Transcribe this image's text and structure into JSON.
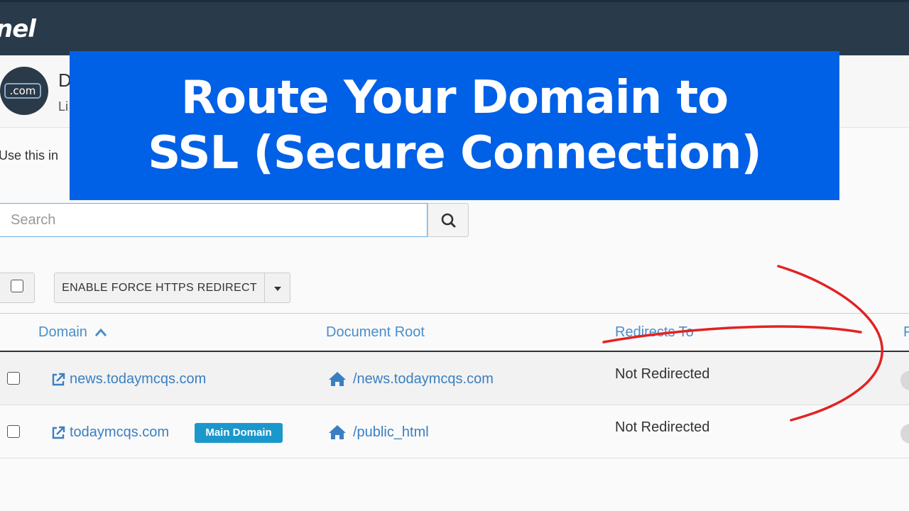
{
  "topbar": {
    "logo_fragment": "nel"
  },
  "header": {
    "icon_label": ".com",
    "title_fragment": "D",
    "subtitle_fragment": "Li",
    "intro_fragment": "Use this in"
  },
  "banner": {
    "line1": "Route Your Domain to",
    "line2": "SSL (Secure Connection)",
    "color": "#0060e6"
  },
  "search": {
    "placeholder": "Search",
    "value": ""
  },
  "toolbar": {
    "enable_label": "ENABLE FORCE HTTPS REDIRECT"
  },
  "table": {
    "headers": {
      "domain": "Domain",
      "doc_root": "Document Root",
      "redirects_to": "Redirects To",
      "force": "F"
    },
    "rows": [
      {
        "domain": "news.todaymcqs.com",
        "doc_root": "/news.todaymcqs.com",
        "redirect": "Not Redirected",
        "badge": ""
      },
      {
        "domain": "todaymcqs.com",
        "doc_root": "/public_html",
        "redirect": "Not Redirected",
        "badge": "Main Domain"
      }
    ]
  },
  "icons": [
    "external-link-icon",
    "home-icon",
    "search-icon",
    "sort-up-icon",
    "caret-down-icon"
  ],
  "colors": {
    "topbar": "#293a4a",
    "link": "#3a7fc1",
    "badge": "#1a98cc",
    "annotation": "#e32222"
  }
}
